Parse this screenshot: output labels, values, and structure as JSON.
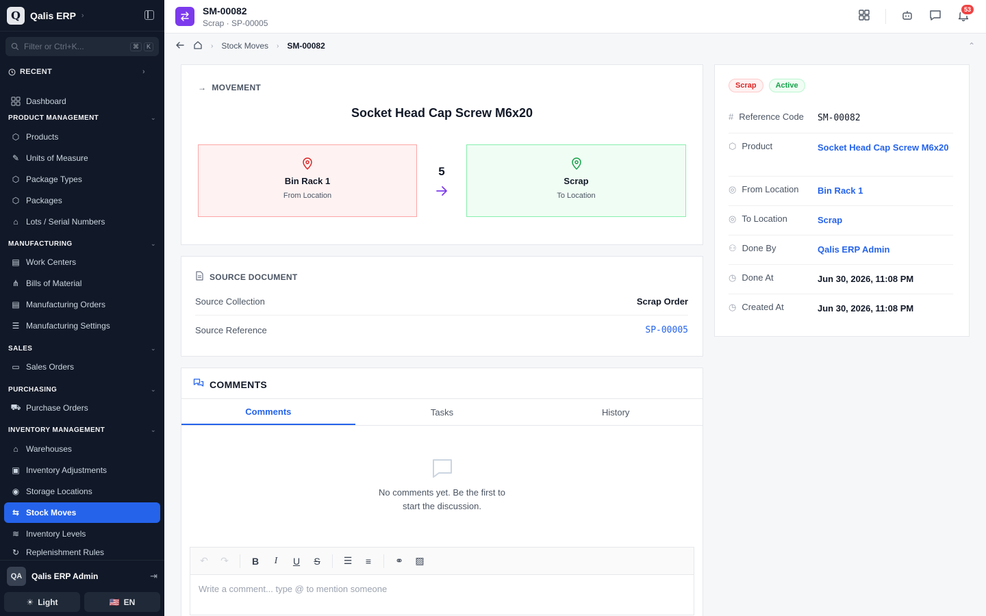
{
  "app": {
    "logo_letter": "Q",
    "name": "Qalis ERP"
  },
  "sidebar": {
    "filter_placeholder": "Filter or Ctrl+K...",
    "kbd": [
      "⌘",
      "K"
    ],
    "recent": "RECENT",
    "dashboard": "Dashboard",
    "sections": [
      {
        "title": "PRODUCT MANAGEMENT",
        "items": [
          "Products",
          "Units of Measure",
          "Package Types",
          "Packages",
          "Lots / Serial Numbers"
        ]
      },
      {
        "title": "MANUFACTURING",
        "items": [
          "Work Centers",
          "Bills of Material",
          "Manufacturing Orders",
          "Manufacturing Settings"
        ]
      },
      {
        "title": "SALES",
        "items": [
          "Sales Orders"
        ]
      },
      {
        "title": "PURCHASING",
        "items": [
          "Purchase Orders"
        ]
      },
      {
        "title": "INVENTORY MANAGEMENT",
        "items": [
          "Warehouses",
          "Inventory Adjustments",
          "Storage Locations",
          "Stock Moves",
          "Inventory Levels",
          "Replenishment Rules"
        ]
      }
    ],
    "user": {
      "initials": "QA",
      "name": "Qalis ERP Admin"
    },
    "theme": "Light",
    "lang": "EN",
    "lang_flag": "🇺🇸"
  },
  "header": {
    "title": "SM-00082",
    "subtitle": "Scrap · SP-00005",
    "notif_count": "53"
  },
  "breadcrumb": {
    "items": [
      "Stock Moves",
      "SM-00082"
    ]
  },
  "movement": {
    "heading": "MOVEMENT",
    "product": "Socket Head Cap Screw M6x20",
    "from": {
      "name": "Bin Rack 1",
      "label": "From Location"
    },
    "to": {
      "name": "Scrap",
      "label": "To Location"
    },
    "quantity": "5"
  },
  "source": {
    "heading": "SOURCE DOCUMENT",
    "rows": [
      {
        "label": "Source Collection",
        "value": "Scrap Order"
      },
      {
        "label": "Source Reference",
        "value": "SP-00005"
      }
    ]
  },
  "comments": {
    "heading": "COMMENTS",
    "tabs": [
      "Comments",
      "Tasks",
      "History"
    ],
    "empty_line1": "No comments yet. Be the first to",
    "empty_line2": "start the discussion.",
    "placeholder": "Write a comment... type @ to mention someone"
  },
  "details": {
    "badges": [
      "Scrap",
      "Active"
    ],
    "rows": [
      {
        "label": "Reference Code",
        "value": "SM-00082"
      },
      {
        "label": "Product",
        "value": "Socket Head Cap Screw M6x20"
      },
      {
        "label": "From Location",
        "value": "Bin Rack 1"
      },
      {
        "label": "To Location",
        "value": "Scrap"
      },
      {
        "label": "Done By",
        "value": "Qalis ERP Admin"
      },
      {
        "label": "Done At",
        "value": "Jun 30, 2026, 11:08 PM"
      },
      {
        "label": "Created At",
        "value": "Jun 30, 2026, 11:08 PM"
      }
    ]
  },
  "colors": {
    "accent": "#2563eb",
    "sidebar_bg": "#111827",
    "header_icon": "#7c3aed",
    "from_bg": "#fef2f2",
    "to_bg": "#f0fdf4"
  }
}
